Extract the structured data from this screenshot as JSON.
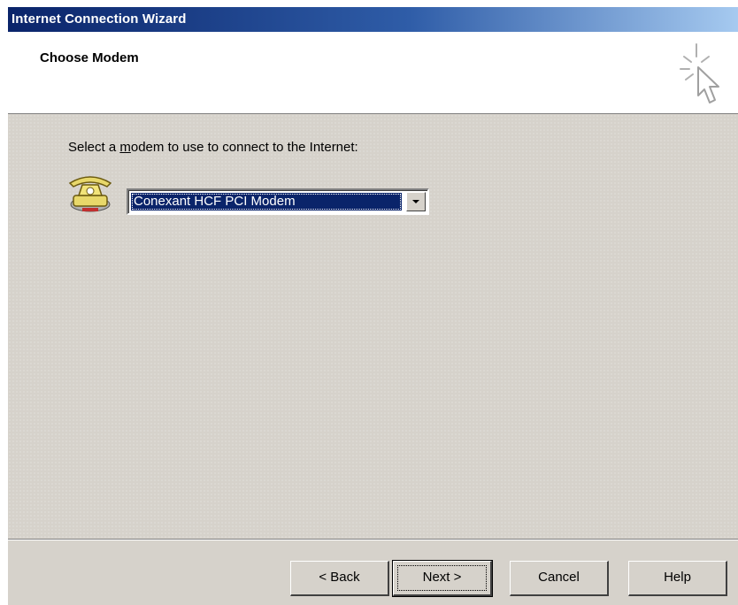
{
  "window": {
    "title": "Internet Connection Wizard"
  },
  "header": {
    "title": "Choose Modem",
    "icon": "wizard-cursor-icon"
  },
  "content": {
    "prompt_before": "Select a ",
    "prompt_accel": "m",
    "prompt_after": "odem to use to connect to the Internet:",
    "modem_icon": "telephone-modem-icon",
    "selected_modem": "Conexant HCF PCI Modem"
  },
  "buttons": {
    "back": "< Back",
    "next": "Next >",
    "cancel": "Cancel",
    "help": "Help"
  },
  "colors": {
    "titlebar_start": "#0a246a",
    "titlebar_end": "#a6caf0",
    "dialog_face": "#d6d2cb",
    "selection": "#0a246a"
  }
}
